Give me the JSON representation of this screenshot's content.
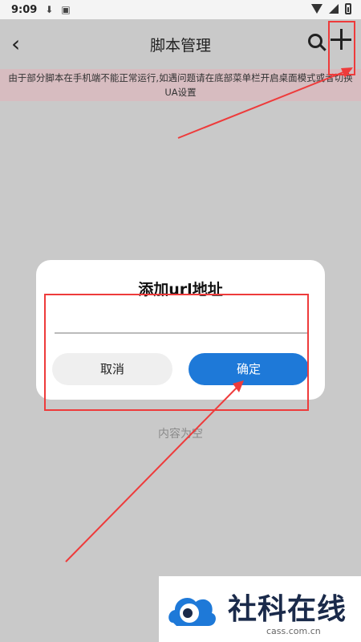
{
  "status_bar": {
    "time": "9:09",
    "icons": [
      "download-icon",
      "photo-icon",
      "wifi-icon",
      "signal-icon",
      "battery-icon"
    ]
  },
  "app_bar": {
    "title": "脚本管理"
  },
  "notice": "由于部分脚本在手机端不能正常运行,如遇问题请在底部菜单栏开启桌面模式或者切换UA设置",
  "empty_text": "内容为空",
  "dialog": {
    "title": "添加url地址",
    "input_value": "",
    "cancel_label": "取消",
    "ok_label": "确定"
  },
  "watermark": {
    "brand": "社科在线",
    "url": "cass.com.cn"
  },
  "colors": {
    "accent": "#1e79d8",
    "annotation": "#ee3b3b",
    "overlay": "#c9c9c9",
    "notice_bg": "#d7bcc0"
  }
}
